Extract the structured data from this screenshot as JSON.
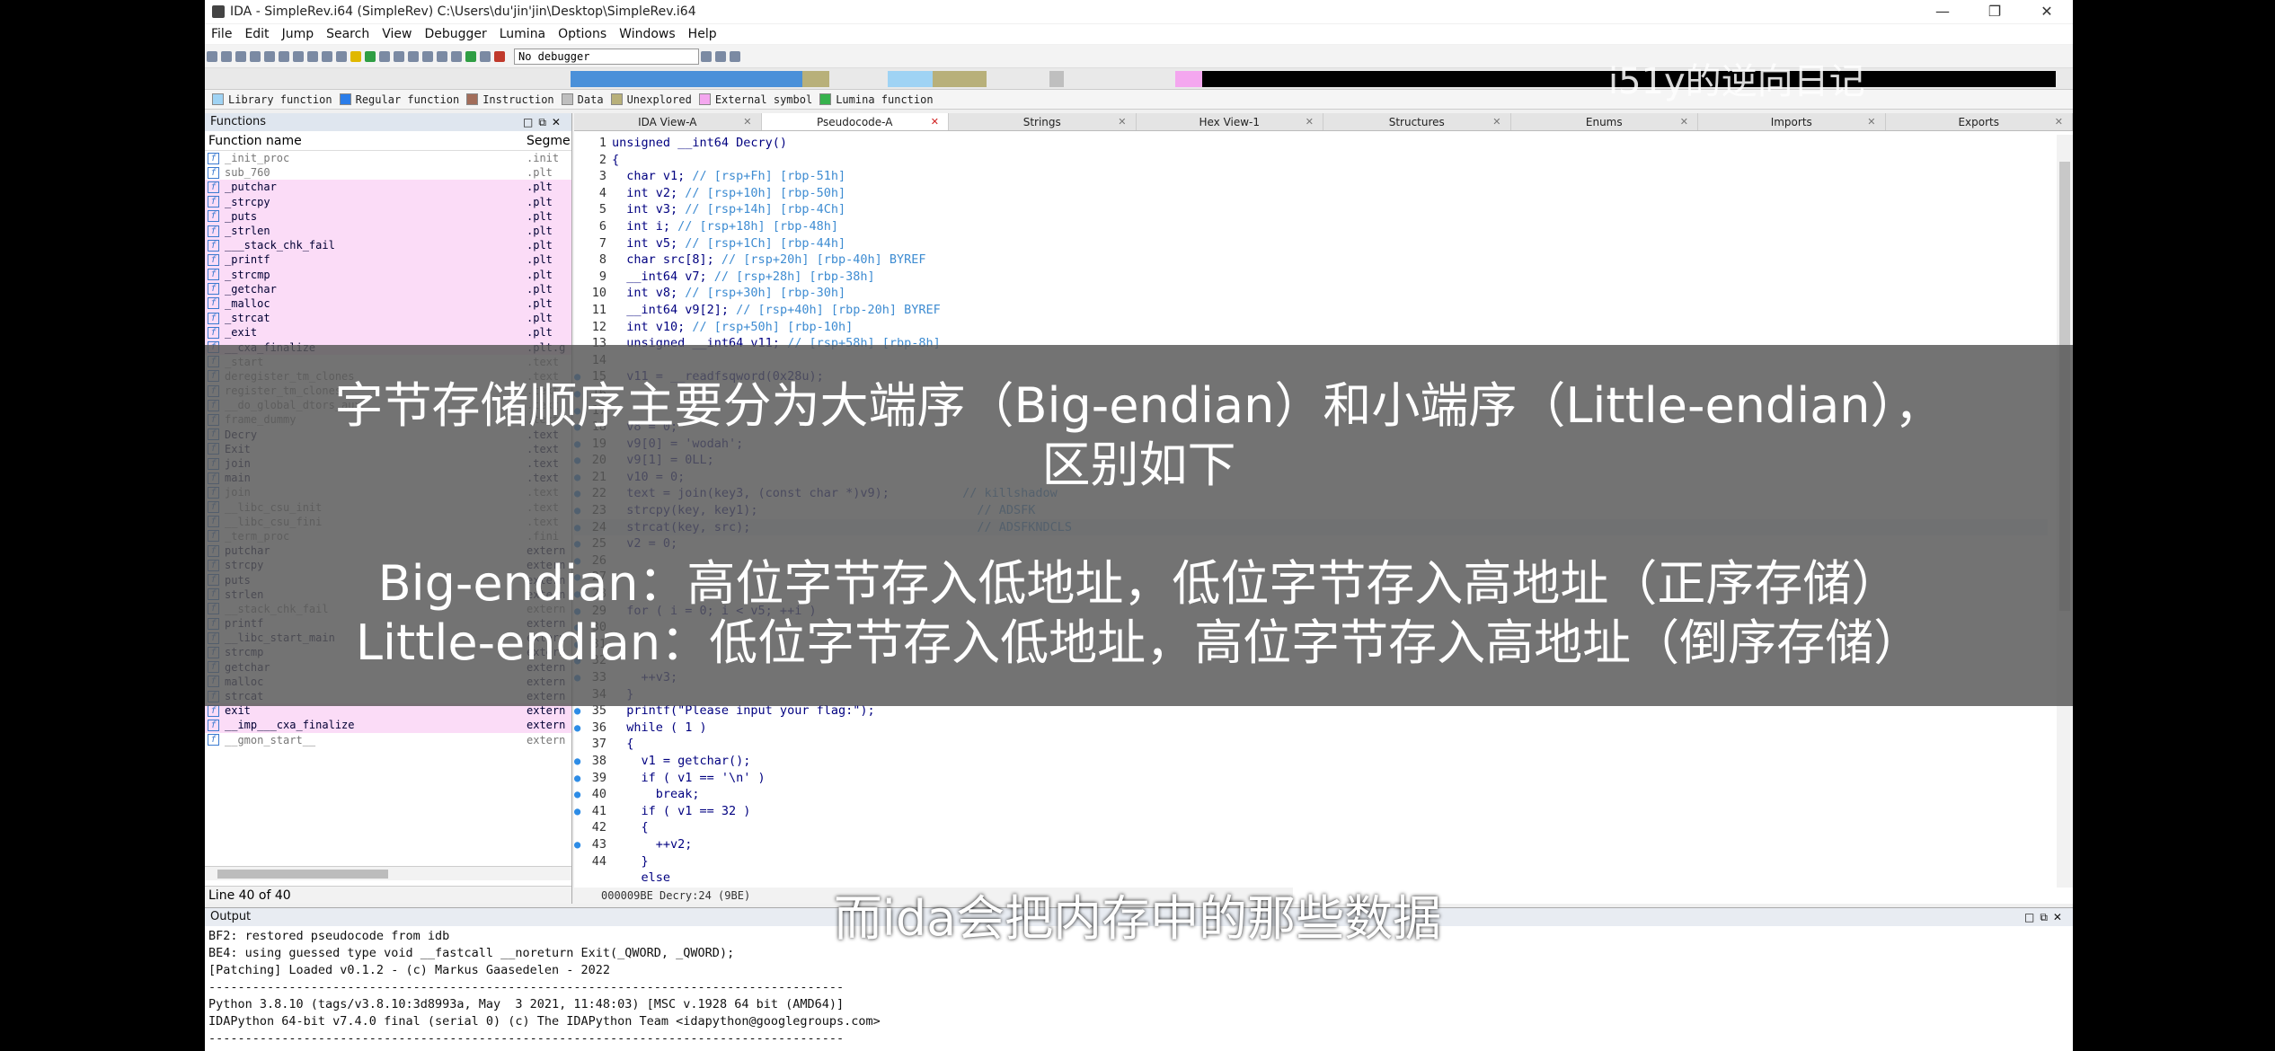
{
  "window": {
    "title": "IDA - SimpleRev.i64 (SimpleRev) C:\\Users\\du'jin'jin\\Desktop\\SimpleRev.i64",
    "minimize": "—",
    "maximize": "❐",
    "close": "✕"
  },
  "menu": [
    "File",
    "Edit",
    "Jump",
    "Search",
    "View",
    "Debugger",
    "Lumina",
    "Options",
    "Windows",
    "Help"
  ],
  "toolbar": {
    "debugger": "No debugger"
  },
  "watermark": "i51y的逆向日记",
  "legend": [
    {
      "label": "Library function",
      "color": "#9fd3f4"
    },
    {
      "label": "Regular function",
      "color": "#2b7de9"
    },
    {
      "label": "Instruction",
      "color": "#a26d5a"
    },
    {
      "label": "Data",
      "color": "#bfbfbf"
    },
    {
      "label": "Unexplored",
      "color": "#b8b07a"
    },
    {
      "label": "External symbol",
      "color": "#f4a7ef"
    },
    {
      "label": "Lumina function",
      "color": "#37b24d"
    }
  ],
  "functions_panel": {
    "title": "Functions",
    "col_name": "Function name",
    "col_segment": "Segme",
    "rows": [
      {
        "name": "_init_proc",
        "seg": ".init",
        "style": "gray"
      },
      {
        "name": "sub_760",
        "seg": ".plt",
        "style": "gray"
      },
      {
        "name": "_putchar",
        "seg": ".plt",
        "style": "pink"
      },
      {
        "name": "_strcpy",
        "seg": ".plt",
        "style": "pink"
      },
      {
        "name": "_puts",
        "seg": ".plt",
        "style": "pink"
      },
      {
        "name": "_strlen",
        "seg": ".plt",
        "style": "pink"
      },
      {
        "name": "___stack_chk_fail",
        "seg": ".plt",
        "style": "pink"
      },
      {
        "name": "_printf",
        "seg": ".plt",
        "style": "pink"
      },
      {
        "name": "_strcmp",
        "seg": ".plt",
        "style": "pink"
      },
      {
        "name": "_getchar",
        "seg": ".plt",
        "style": "pink"
      },
      {
        "name": "_malloc",
        "seg": ".plt",
        "style": "pink"
      },
      {
        "name": "_strcat",
        "seg": ".plt",
        "style": "pink"
      },
      {
        "name": "_exit",
        "seg": ".plt",
        "style": "pink"
      },
      {
        "name": "__cxa_finalize",
        "seg": ".plt.g",
        "style": "pink"
      },
      {
        "name": "_start",
        "seg": ".text",
        "style": "gray"
      },
      {
        "name": "deregister_tm_clones",
        "seg": ".text",
        "style": "gray"
      },
      {
        "name": "register_tm_clones",
        "seg": ".text",
        "style": "gray"
      },
      {
        "name": "__do_global_dtors_aux",
        "seg": ".text",
        "style": "gray"
      },
      {
        "name": "frame_dummy",
        "seg": ".text",
        "style": "gray"
      },
      {
        "name": "Decry",
        "seg": ".text",
        "style": ""
      },
      {
        "name": "Exit",
        "seg": ".text",
        "style": ""
      },
      {
        "name": "join",
        "seg": ".text",
        "style": ""
      },
      {
        "name": "main",
        "seg": ".text",
        "style": ""
      },
      {
        "name": "join",
        "seg": ".text",
        "style": "gray"
      },
      {
        "name": "__libc_csu_init",
        "seg": ".text",
        "style": "gray"
      },
      {
        "name": "__libc_csu_fini",
        "seg": ".text",
        "style": "gray"
      },
      {
        "name": "_term_proc",
        "seg": ".fini",
        "style": "gray"
      },
      {
        "name": "putchar",
        "seg": "extern",
        "style": ""
      },
      {
        "name": "strcpy",
        "seg": "extern",
        "style": ""
      },
      {
        "name": "puts",
        "seg": "extern",
        "style": ""
      },
      {
        "name": "strlen",
        "seg": "extern",
        "style": ""
      },
      {
        "name": "__stack_chk_fail",
        "seg": "extern",
        "style": "gray"
      },
      {
        "name": "printf",
        "seg": "extern",
        "style": ""
      },
      {
        "name": "__libc_start_main",
        "seg": "extern",
        "style": ""
      },
      {
        "name": "strcmp",
        "seg": "extern",
        "style": ""
      },
      {
        "name": "getchar",
        "seg": "extern",
        "style": ""
      },
      {
        "name": "malloc",
        "seg": "extern",
        "style": ""
      },
      {
        "name": "strcat",
        "seg": "extern",
        "style": ""
      },
      {
        "name": "exit",
        "seg": "extern",
        "style": "pink"
      },
      {
        "name": "__imp___cxa_finalize",
        "seg": "extern",
        "style": "pink"
      },
      {
        "name": "__gmon_start__",
        "seg": "extern",
        "style": "gray"
      }
    ],
    "status": "Line 40 of 40"
  },
  "tabs": [
    {
      "label": "IDA View-A",
      "active": false
    },
    {
      "label": "Pseudocode-A",
      "active": true
    },
    {
      "label": "Strings",
      "active": false
    },
    {
      "label": "Hex View-1",
      "active": false
    },
    {
      "label": "Structures",
      "active": false
    },
    {
      "label": "Enums",
      "active": false
    },
    {
      "label": "Imports",
      "active": false
    },
    {
      "label": "Exports",
      "active": false
    }
  ],
  "code_lines": [
    {
      "n": "1",
      "dot": false,
      "code": "unsigned __int64 Decry()",
      "cmt": ""
    },
    {
      "n": "2",
      "dot": false,
      "code": "{",
      "cmt": ""
    },
    {
      "n": "3",
      "dot": false,
      "code": "  char v1; ",
      "cmt": "// [rsp+Fh] [rbp-51h]"
    },
    {
      "n": "4",
      "dot": false,
      "code": "  int v2; ",
      "cmt": "// [rsp+10h] [rbp-50h]"
    },
    {
      "n": "5",
      "dot": false,
      "code": "  int v3; ",
      "cmt": "// [rsp+14h] [rbp-4Ch]"
    },
    {
      "n": "6",
      "dot": false,
      "code": "  int i; ",
      "cmt": "// [rsp+18h] [rbp-48h]"
    },
    {
      "n": "7",
      "dot": false,
      "code": "  int v5; ",
      "cmt": "// [rsp+1Ch] [rbp-44h]"
    },
    {
      "n": "8",
      "dot": false,
      "code": "  char src[8]; ",
      "cmt": "// [rsp+20h] [rbp-40h] BYREF"
    },
    {
      "n": "9",
      "dot": false,
      "code": "  __int64 v7; ",
      "cmt": "// [rsp+28h] [rbp-38h]"
    },
    {
      "n": "10",
      "dot": false,
      "code": "  int v8; ",
      "cmt": "// [rsp+30h] [rbp-30h]"
    },
    {
      "n": "11",
      "dot": false,
      "code": "  __int64 v9[2]; ",
      "cmt": "// [rsp+40h] [rbp-20h] BYREF"
    },
    {
      "n": "12",
      "dot": false,
      "code": "  int v10; ",
      "cmt": "// [rsp+50h] [rbp-10h]"
    },
    {
      "n": "13",
      "dot": false,
      "code": "  unsigned __int64 v11; ",
      "cmt": "// [rsp+58h] [rbp-8h]"
    },
    {
      "n": "14",
      "dot": false,
      "code": "",
      "cmt": ""
    },
    {
      "n": "15",
      "dot": true,
      "code": "  v11 = __readfsqword(0x28u);",
      "cmt": ""
    },
    {
      "n": "16",
      "dot": true,
      "code": "",
      "cmt": ""
    },
    {
      "n": "17",
      "dot": true,
      "code": "",
      "cmt": ""
    },
    {
      "n": "18",
      "dot": true,
      "code": "  v8 = 0;",
      "cmt": ""
    },
    {
      "n": "19",
      "dot": true,
      "code": "  v9[0] = 'wodah';",
      "cmt": ""
    },
    {
      "n": "20",
      "dot": true,
      "code": "  v9[1] = 0LL;",
      "cmt": ""
    },
    {
      "n": "21",
      "dot": true,
      "code": "  v10 = 0;",
      "cmt": ""
    },
    {
      "n": "22",
      "dot": true,
      "code": "  text = join(key3, (const char *)v9);          ",
      "cmt": "// killshadow"
    },
    {
      "n": "23",
      "dot": true,
      "code": "  strcpy(key, key1);                              ",
      "cmt": "// ADSFK"
    },
    {
      "n": "24",
      "dot": true,
      "code": "  strcat(key, src);                               ",
      "cmt": "// ADSFKNDCLS"
    },
    {
      "n": "25",
      "dot": true,
      "code": "  v2 = 0;",
      "cmt": ""
    },
    {
      "n": "26",
      "dot": true,
      "code": "",
      "cmt": ""
    },
    {
      "n": "27",
      "dot": true,
      "code": "",
      "cmt": ""
    },
    {
      "n": "28",
      "dot": true,
      "code": "",
      "cmt": ""
    },
    {
      "n": "29",
      "dot": true,
      "code": "  for ( i = 0; i < v5; ++i )",
      "cmt": ""
    },
    {
      "n": "30",
      "dot": true,
      "code": "",
      "cmt": ""
    },
    {
      "n": "31",
      "dot": true,
      "code": "",
      "cmt": ""
    },
    {
      "n": "32",
      "dot": true,
      "code": "",
      "cmt": ""
    },
    {
      "n": "33",
      "dot": true,
      "code": "    ++v3;",
      "cmt": ""
    },
    {
      "n": "34",
      "dot": false,
      "code": "  }",
      "cmt": ""
    },
    {
      "n": "35",
      "dot": true,
      "code": "  printf(\"Please input your flag:\");",
      "cmt": ""
    },
    {
      "n": "36",
      "dot": true,
      "code": "  while ( 1 )",
      "cmt": ""
    },
    {
      "n": "37",
      "dot": false,
      "code": "  {",
      "cmt": ""
    },
    {
      "n": "38",
      "dot": true,
      "code": "    v1 = getchar();",
      "cmt": ""
    },
    {
      "n": "39",
      "dot": true,
      "code": "    if ( v1 == '\\n' )",
      "cmt": ""
    },
    {
      "n": "40",
      "dot": true,
      "code": "      break;",
      "cmt": ""
    },
    {
      "n": "41",
      "dot": true,
      "code": "    if ( v1 == 32 )",
      "cmt": ""
    },
    {
      "n": "42",
      "dot": false,
      "code": "    {",
      "cmt": ""
    },
    {
      "n": "43",
      "dot": true,
      "code": "      ++v2;",
      "cmt": ""
    },
    {
      "n": "44",
      "dot": false,
      "code": "    }",
      "cmt": ""
    },
    {
      "n": "",
      "dot": false,
      "code": "    else",
      "cmt": ""
    }
  ],
  "address_bar": "000009BE Decry:24 (9BE)",
  "output_panel": {
    "title": "Output",
    "lines": [
      "BF2: restored pseudocode from idb",
      "BE4: using guessed type void __fastcall __noreturn Exit(_QWORD, _QWORD);",
      "[Patching] Loaded v0.1.2 - (c) Markus Gaasedelen - 2022",
      "---------------------------------------------------------------------------------------",
      "Python 3.8.10 (tags/v3.8.10:3d8993a, May  3 2021, 11:48:03) [MSC v.1928 64 bit (AMD64)]",
      "IDAPython 64-bit v7.4.0 final (serial 0) (c) The IDAPython Team <idapython@googlegroups.com>",
      "---------------------------------------------------------------------------------------"
    ]
  },
  "overlay": {
    "line1": "字节存储顺序主要分为大端序（Big-endian）和小端序（Little-endian），",
    "line2": "区别如下",
    "line3": "Big-endian：高位字节存入低地址，低位字节存入高地址（正序存储）",
    "line4": "Little-endian：低位字节存入低地址，高位字节存入高地址（倒序存储）"
  },
  "subtitle": "而ida会把内存中的那些数据"
}
